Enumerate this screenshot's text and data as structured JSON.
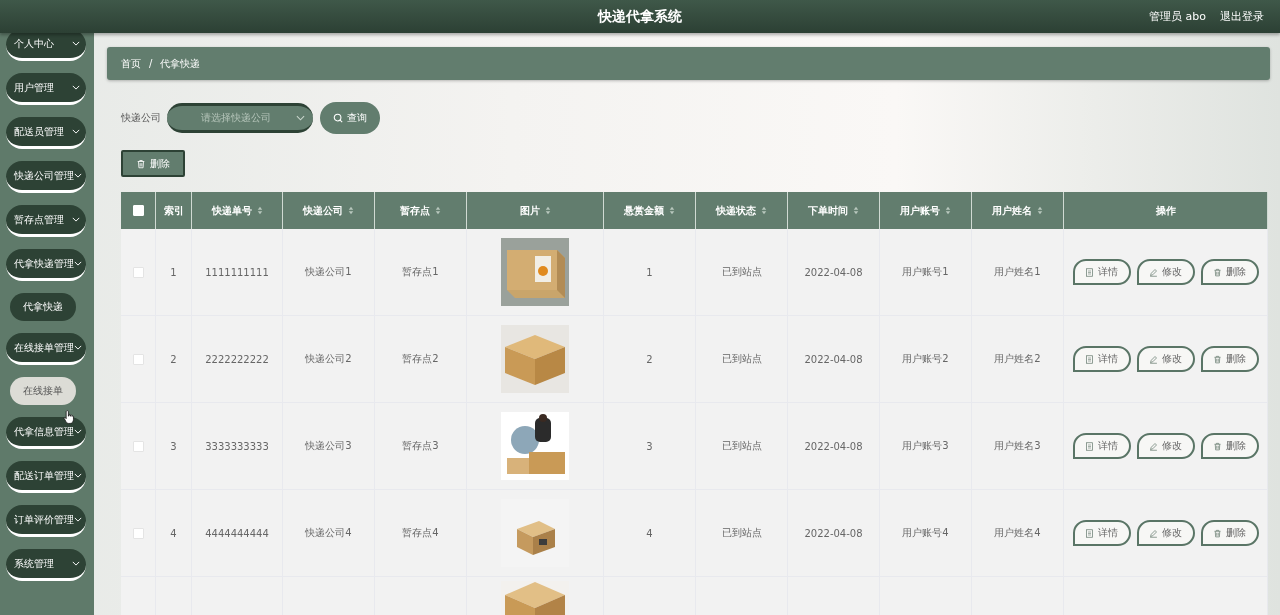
{
  "header": {
    "title": "快递代拿系统",
    "user": "管理员 abo",
    "logout": "退出登录"
  },
  "sidebar": {
    "items": [
      {
        "label": "个人中心"
      },
      {
        "label": "用户管理"
      },
      {
        "label": "配送员管理"
      },
      {
        "label": "快递公司管理"
      },
      {
        "label": "暂存点管理"
      },
      {
        "label": "代拿快递管理",
        "children": [
          {
            "label": "代拿快递",
            "selected": true,
            "hovered": false
          }
        ]
      },
      {
        "label": "在线接单管理",
        "children": [
          {
            "label": "在线接单",
            "selected": false,
            "hovered": true
          }
        ]
      },
      {
        "label": "代拿信息管理"
      },
      {
        "label": "配送订单管理"
      },
      {
        "label": "订单评价管理"
      },
      {
        "label": "系统管理"
      }
    ]
  },
  "breadcrumb": {
    "items": [
      "首页",
      "代拿快递"
    ],
    "separator": "/"
  },
  "filter": {
    "label": "快递公司",
    "placeholder": "请选择快递公司",
    "search_button": "查询"
  },
  "delete_button": "删除",
  "table": {
    "select_all_checked": false,
    "columns": [
      {
        "label": "索引",
        "sortable": false
      },
      {
        "label": "快递单号",
        "sortable": true
      },
      {
        "label": "快递公司",
        "sortable": true
      },
      {
        "label": "暂存点",
        "sortable": true
      },
      {
        "label": "图片",
        "sortable": true
      },
      {
        "label": "悬赏金额",
        "sortable": true
      },
      {
        "label": "快递状态",
        "sortable": true
      },
      {
        "label": "下单时间",
        "sortable": true
      },
      {
        "label": "用户账号",
        "sortable": true
      },
      {
        "label": "用户姓名",
        "sortable": true
      },
      {
        "label": "操作",
        "sortable": false
      }
    ],
    "rows": [
      {
        "checked": false,
        "cells": [
          "1",
          "1111111111",
          "快递公司1",
          "暂存点1",
          {
            "kind": "picture"
          },
          "1",
          "已到站点",
          "2022-04-08",
          "用户账号1",
          "用户姓名1"
        ],
        "actions": [
          {
            "kind": "detail",
            "label": "详情"
          },
          {
            "kind": "edit",
            "label": "修改"
          },
          {
            "kind": "delete",
            "label": "删除"
          }
        ]
      },
      {
        "checked": false,
        "cells": [
          "2",
          "2222222222",
          "快递公司2",
          "暂存点2",
          {
            "kind": "picture"
          },
          "2",
          "已到站点",
          "2022-04-08",
          "用户账号2",
          "用户姓名2"
        ],
        "actions": [
          {
            "kind": "detail",
            "label": "详情"
          },
          {
            "kind": "edit",
            "label": "修改"
          },
          {
            "kind": "delete",
            "label": "删除"
          }
        ]
      },
      {
        "checked": false,
        "cells": [
          "3",
          "3333333333",
          "快递公司3",
          "暂存点3",
          {
            "kind": "picture"
          },
          "3",
          "已到站点",
          "2022-04-08",
          "用户账号3",
          "用户姓名3"
        ],
        "actions": [
          {
            "kind": "detail",
            "label": "详情"
          },
          {
            "kind": "edit",
            "label": "修改"
          },
          {
            "kind": "delete",
            "label": "删除"
          }
        ]
      },
      {
        "checked": false,
        "cells": [
          "4",
          "4444444444",
          "快递公司4",
          "暂存点4",
          {
            "kind": "picture"
          },
          "4",
          "已到站点",
          "2022-04-08",
          "用户账号4",
          "用户姓名4"
        ],
        "actions": [
          {
            "kind": "detail",
            "label": "详情"
          },
          {
            "kind": "edit",
            "label": "修改"
          },
          {
            "kind": "delete",
            "label": "删除"
          }
        ]
      },
      {
        "cells": [
          null,
          null,
          null,
          null,
          {
            "kind": "picture"
          }
        ]
      }
    ]
  }
}
